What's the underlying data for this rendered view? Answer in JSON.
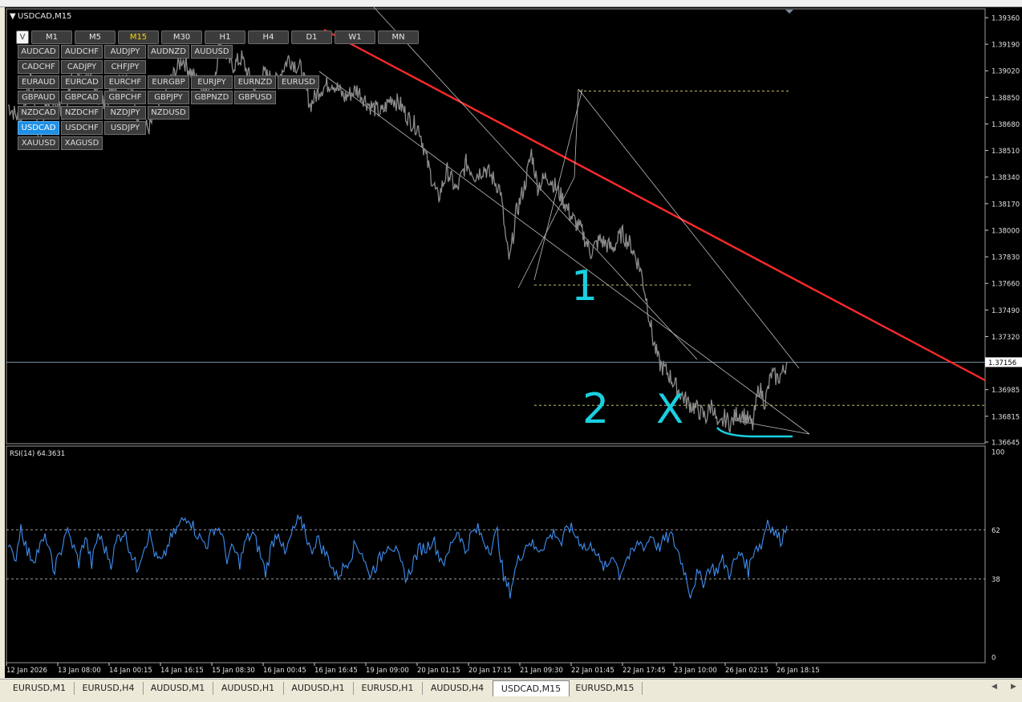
{
  "window": {
    "title": "USDCAD,M15"
  },
  "timeframes": {
    "v_label": "V",
    "items": [
      "M1",
      "M5",
      "M15",
      "M30",
      "H1",
      "H4",
      "D1",
      "W1",
      "MN"
    ],
    "active": "M15"
  },
  "symbols": {
    "rows": [
      [
        "AUDCAD",
        "AUDCHF",
        "AUDJPY",
        "AUDNZD",
        "AUDUSD"
      ],
      [
        "CADCHF",
        "CADJPY",
        "CHFJPY"
      ],
      [
        "EURAUD",
        "EURCAD",
        "EURCHF",
        "EURGBP",
        "EURJPY",
        "EURNZD",
        "EURUSD"
      ],
      [
        "GBPAUD",
        "GBPCAD",
        "GBPCHF",
        "GBPJPY",
        "GBPNZD",
        "GBPUSD"
      ],
      [
        "NZDCAD",
        "NZDCHF",
        "NZDJPY",
        "NZDUSD"
      ],
      [
        "USDCAD",
        "USDCHF",
        "USDJPY"
      ],
      [
        "XAUUSD",
        "XAGUSD"
      ]
    ],
    "active": "USDCAD"
  },
  "chart_data": [
    {
      "type": "line",
      "symbol": "USDCAD",
      "timeframe": "M15",
      "y_ticks": [
        1.3936,
        1.3919,
        1.3902,
        1.3885,
        1.3868,
        1.3851,
        1.3834,
        1.3817,
        1.38,
        1.3783,
        1.3766,
        1.3749,
        1.3732,
        1.3698,
        1.3681,
        1.36645
      ],
      "y_tick_labels": [
        "1.39360",
        "1.39190",
        "1.39020",
        "1.38850",
        "1.38680",
        "1.38510",
        "1.38340",
        "1.38170",
        "1.38000",
        "1.37830",
        "1.37660",
        "1.37490",
        "1.37320",
        "1.36985",
        "1.36815",
        "1.36645"
      ],
      "ylim": [
        1.36645,
        1.3936
      ],
      "current_price": 1.37156,
      "current_price_label": "1.37156",
      "x_tick_labels": [
        "12 Jan 2026",
        "13 Jan 08:00",
        "14 Jan 00:15",
        "14 Jan 16:15",
        "15 Jan 08:30",
        "16 Jan 00:45",
        "16 Jan 16:45",
        "19 Jan 09:00",
        "20 Jan 01:15",
        "20 Jan 17:15",
        "21 Jan 09:30",
        "22 Jan 01:45",
        "22 Jan 17:45",
        "23 Jan 10:00",
        "26 Jan 02:15",
        "26 Jan 18:15"
      ],
      "price_path": [
        [
          0,
          1.388
        ],
        [
          8,
          1.387
        ],
        [
          15,
          1.39
        ],
        [
          20,
          1.3855
        ],
        [
          24,
          1.388
        ],
        [
          30,
          1.3885
        ],
        [
          36,
          1.387
        ],
        [
          40,
          1.3895
        ],
        [
          48,
          1.3905
        ],
        [
          56,
          1.389
        ],
        [
          62,
          1.388
        ],
        [
          68,
          1.3893
        ],
        [
          76,
          1.39
        ],
        [
          84,
          1.387
        ],
        [
          90,
          1.3865
        ],
        [
          96,
          1.3875
        ],
        [
          104,
          1.3895
        ],
        [
          112,
          1.391
        ],
        [
          118,
          1.39
        ],
        [
          126,
          1.389
        ],
        [
          132,
          1.3895
        ],
        [
          136,
          1.392
        ],
        [
          144,
          1.3905
        ],
        [
          150,
          1.391
        ],
        [
          158,
          1.389
        ],
        [
          164,
          1.39
        ],
        [
          172,
          1.3895
        ],
        [
          180,
          1.391
        ],
        [
          188,
          1.3903
        ],
        [
          194,
          1.388
        ],
        [
          200,
          1.389
        ],
        [
          208,
          1.3895
        ],
        [
          216,
          1.3885
        ],
        [
          224,
          1.389
        ],
        [
          232,
          1.388
        ],
        [
          240,
          1.3875
        ],
        [
          246,
          1.3885
        ],
        [
          252,
          1.388
        ],
        [
          258,
          1.387
        ],
        [
          264,
          1.3865
        ],
        [
          270,
          1.384
        ],
        [
          276,
          1.382
        ],
        [
          282,
          1.3838
        ],
        [
          288,
          1.3825
        ],
        [
          294,
          1.3843
        ],
        [
          300,
          1.3835
        ],
        [
          306,
          1.384
        ],
        [
          312,
          1.3832
        ],
        [
          316,
          1.3826
        ],
        [
          320,
          1.379
        ],
        [
          322,
          1.378
        ],
        [
          326,
          1.381
        ],
        [
          332,
          1.383
        ],
        [
          336,
          1.385
        ],
        [
          340,
          1.3828
        ],
        [
          346,
          1.3835
        ],
        [
          350,
          1.383
        ],
        [
          356,
          1.382
        ],
        [
          362,
          1.3808
        ],
        [
          368,
          1.38
        ],
        [
          374,
          1.3786
        ],
        [
          380,
          1.3794
        ],
        [
          388,
          1.3788
        ],
        [
          394,
          1.3798
        ],
        [
          400,
          1.379
        ],
        [
          406,
          1.3775
        ],
        [
          410,
          1.3755
        ],
        [
          414,
          1.373
        ],
        [
          418,
          1.3715
        ],
        [
          424,
          1.3708
        ],
        [
          430,
          1.3698
        ],
        [
          436,
          1.369
        ],
        [
          442,
          1.3686
        ],
        [
          448,
          1.368
        ],
        [
          452,
          1.369
        ],
        [
          456,
          1.3672
        ],
        [
          460,
          1.368
        ],
        [
          464,
          1.3676
        ],
        [
          468,
          1.3683
        ],
        [
          472,
          1.3682
        ],
        [
          478,
          1.3675
        ],
        [
          482,
          1.37
        ],
        [
          486,
          1.369
        ],
        [
          490,
          1.3708
        ],
        [
          494,
          1.3705
        ],
        [
          498,
          1.371
        ],
        [
          500,
          1.37156
        ]
      ],
      "levels": [
        1.3889,
        1.3765,
        1.3688
      ],
      "annotations": [
        "1",
        "2",
        "X"
      ]
    },
    {
      "type": "line",
      "indicator_label": "RSI(14) 64.3631",
      "ylim": [
        0,
        100
      ],
      "y_tick_labels": [
        "100",
        "62",
        "38",
        "0"
      ],
      "levels": [
        62,
        38
      ],
      "values": [
        57,
        45,
        64,
        51,
        48,
        54,
        58,
        42,
        49,
        62,
        55,
        46,
        59,
        45,
        60,
        53,
        46,
        58,
        61,
        52,
        43,
        53,
        60,
        48,
        46,
        56,
        61,
        66,
        69,
        62,
        57,
        55,
        63,
        62,
        48,
        53,
        46,
        57,
        60,
        52,
        41,
        55,
        62,
        49,
        59,
        66,
        64,
        51,
        58,
        52,
        47,
        39,
        43,
        48,
        55,
        51,
        40,
        44,
        49,
        56,
        53,
        45,
        38,
        47,
        53,
        53,
        58,
        49,
        46,
        57,
        62,
        51,
        60,
        62,
        56,
        53,
        61,
        38,
        32,
        45,
        52,
        57,
        52,
        54,
        58,
        61,
        55,
        64,
        60,
        56,
        52,
        55,
        45,
        43,
        51,
        40,
        48,
        50,
        56,
        54,
        60,
        53,
        57,
        59,
        52,
        43,
        31,
        40,
        37,
        44,
        42,
        47,
        41,
        47,
        51,
        42,
        54,
        54,
        67,
        61,
        57,
        64
      ]
    }
  ]
}
